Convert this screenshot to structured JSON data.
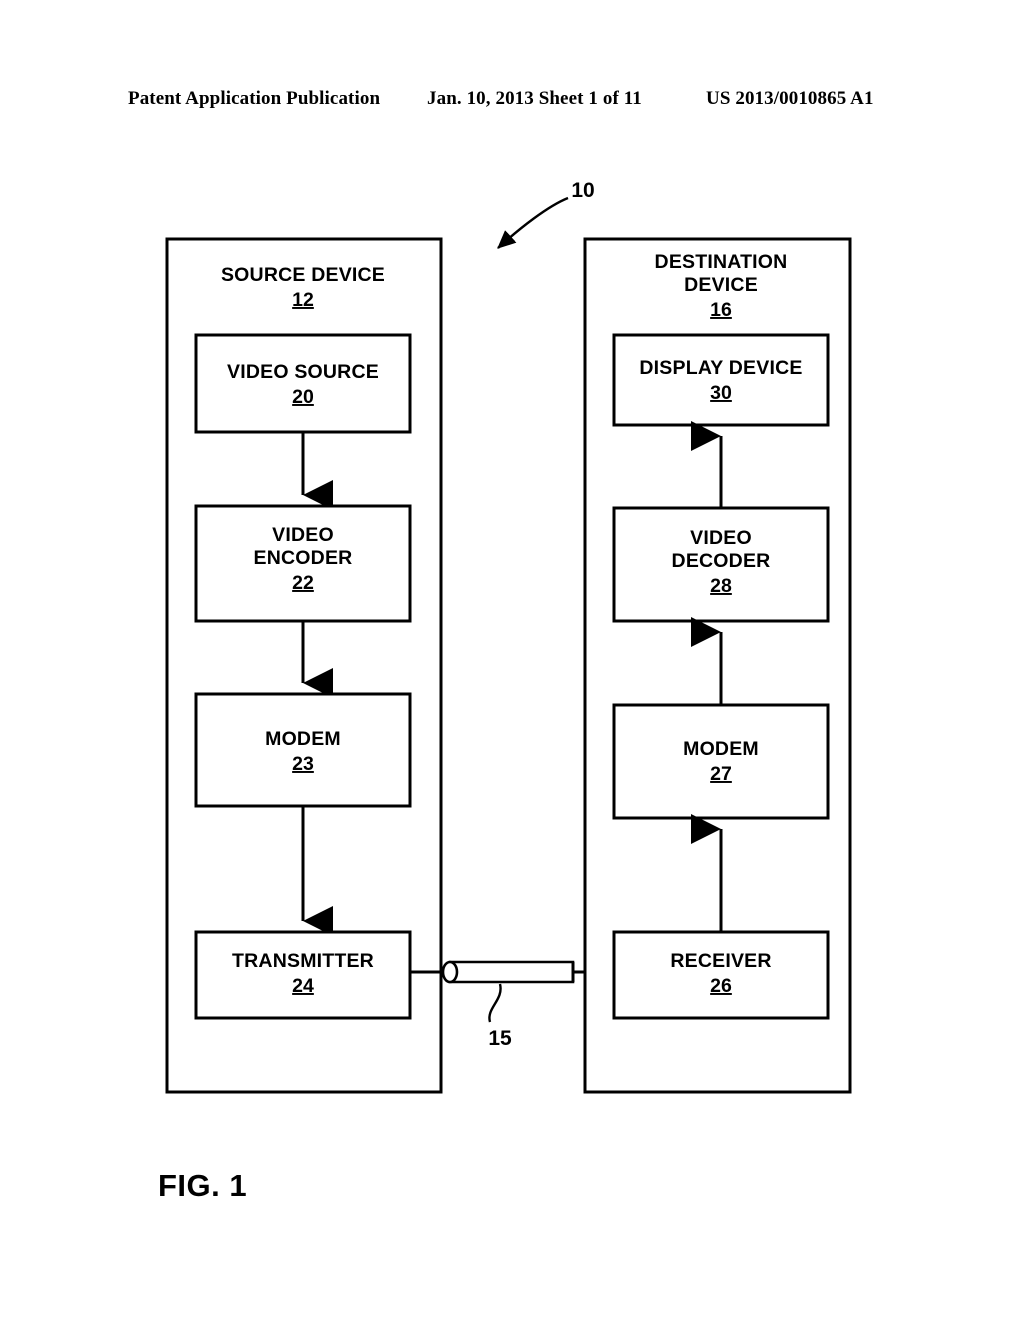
{
  "header": {
    "left": "Patent Application Publication",
    "middle": "Jan. 10, 2013  Sheet 1 of 11",
    "right": "US 2013/0010865 A1"
  },
  "figure": {
    "caption": "FIG. 1",
    "system_ref": "10",
    "link_ref": "15"
  },
  "diagram": {
    "source_device": {
      "title": "SOURCE DEVICE",
      "ref": "12",
      "blocks": [
        {
          "name": "video-source",
          "lines": [
            "VIDEO SOURCE"
          ],
          "ref": "20"
        },
        {
          "name": "video-encoder",
          "lines": [
            "VIDEO",
            "ENCODER"
          ],
          "ref": "22"
        },
        {
          "name": "modem",
          "lines": [
            "MODEM"
          ],
          "ref": "23"
        },
        {
          "name": "transmitter",
          "lines": [
            "TRANSMITTER"
          ],
          "ref": "24"
        }
      ]
    },
    "destination_device": {
      "title_lines": [
        "DESTINATION",
        "DEVICE"
      ],
      "ref": "16",
      "blocks": [
        {
          "name": "display-device",
          "lines": [
            "DISPLAY DEVICE"
          ],
          "ref": "30"
        },
        {
          "name": "video-decoder",
          "lines": [
            "VIDEO",
            "DECODER"
          ],
          "ref": "28"
        },
        {
          "name": "modem",
          "lines": [
            "MODEM"
          ],
          "ref": "27"
        },
        {
          "name": "receiver",
          "lines": [
            "RECEIVER"
          ],
          "ref": "26"
        }
      ]
    }
  },
  "colors": {
    "ink": "#000000",
    "paper": "#ffffff"
  }
}
